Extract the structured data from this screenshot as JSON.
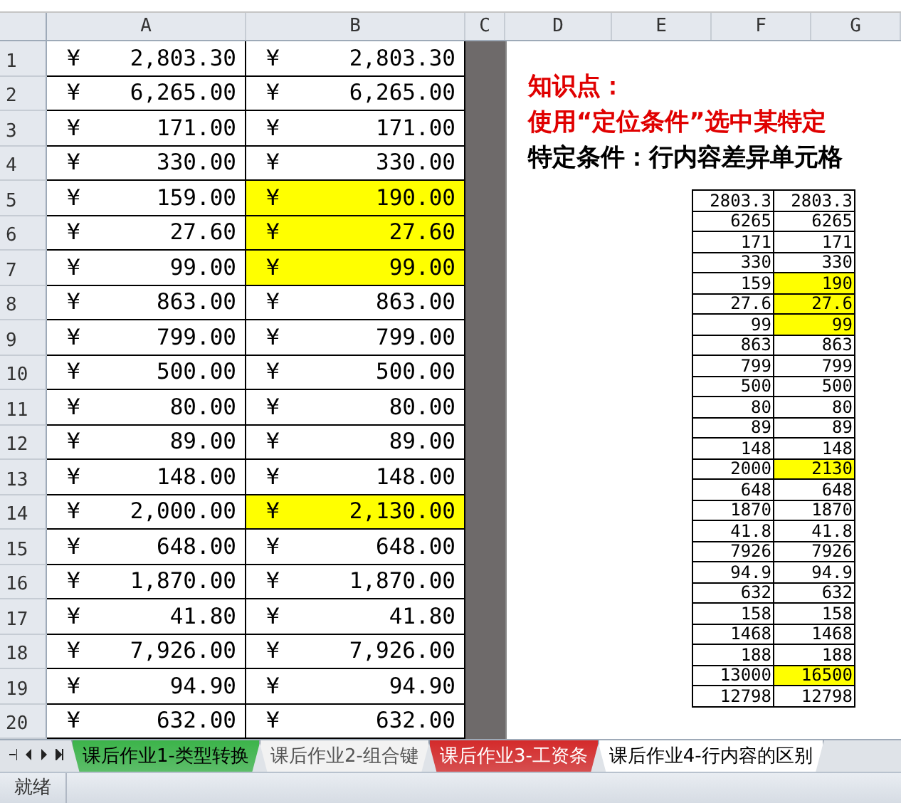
{
  "columns": [
    "A",
    "B",
    "C",
    "D",
    "E",
    "F",
    "G"
  ],
  "rows": [
    {
      "number": "1",
      "a": "2,803.30",
      "b": "2,803.30",
      "highlighted": false
    },
    {
      "number": "2",
      "a": "6,265.00",
      "b": "6,265.00",
      "highlighted": false
    },
    {
      "number": "3",
      "a": "171.00",
      "b": "171.00",
      "highlighted": false
    },
    {
      "number": "4",
      "a": "330.00",
      "b": "330.00",
      "highlighted": false
    },
    {
      "number": "5",
      "a": "159.00",
      "b": "190.00",
      "highlighted": true
    },
    {
      "number": "6",
      "a": "27.60",
      "b": "27.60",
      "highlighted": true
    },
    {
      "number": "7",
      "a": "99.00",
      "b": "99.00",
      "highlighted": true
    },
    {
      "number": "8",
      "a": "863.00",
      "b": "863.00",
      "highlighted": false
    },
    {
      "number": "9",
      "a": "799.00",
      "b": "799.00",
      "highlighted": false
    },
    {
      "number": "10",
      "a": "500.00",
      "b": "500.00",
      "highlighted": false
    },
    {
      "number": "11",
      "a": "80.00",
      "b": "80.00",
      "highlighted": false
    },
    {
      "number": "12",
      "a": "89.00",
      "b": "89.00",
      "highlighted": false
    },
    {
      "number": "13",
      "a": "148.00",
      "b": "148.00",
      "highlighted": false
    },
    {
      "number": "14",
      "a": "2,000.00",
      "b": "2,130.00",
      "highlighted": true
    },
    {
      "number": "15",
      "a": "648.00",
      "b": "648.00",
      "highlighted": false
    },
    {
      "number": "16",
      "a": "1,870.00",
      "b": "1,870.00",
      "highlighted": false
    },
    {
      "number": "17",
      "a": "41.80",
      "b": "41.80",
      "highlighted": false
    },
    {
      "number": "18",
      "a": "7,926.00",
      "b": "7,926.00",
      "highlighted": false
    },
    {
      "number": "19",
      "a": "94.90",
      "b": "94.90",
      "highlighted": false
    },
    {
      "number": "20",
      "a": "632.00",
      "b": "632.00",
      "highlighted": false
    }
  ],
  "currency": "¥",
  "notes": [
    {
      "text": "知识点：",
      "kind": "heading"
    },
    {
      "text": "使用“定位条件”选中某特定",
      "kind": "heading"
    },
    {
      "text": "特定条件：行内容差异单元格",
      "kind": "body"
    }
  ],
  "small_table": [
    {
      "f": "2803.3",
      "g": "2803.3",
      "highlighted": false
    },
    {
      "f": "6265",
      "g": "6265",
      "highlighted": false
    },
    {
      "f": "171",
      "g": "171",
      "highlighted": false
    },
    {
      "f": "330",
      "g": "330",
      "highlighted": false
    },
    {
      "f": "159",
      "g": "190",
      "highlighted": true
    },
    {
      "f": "27.6",
      "g": "27.6",
      "highlighted": true
    },
    {
      "f": "99",
      "g": "99",
      "highlighted": true
    },
    {
      "f": "863",
      "g": "863",
      "highlighted": false
    },
    {
      "f": "799",
      "g": "799",
      "highlighted": false
    },
    {
      "f": "500",
      "g": "500",
      "highlighted": false
    },
    {
      "f": "80",
      "g": "80",
      "highlighted": false
    },
    {
      "f": "89",
      "g": "89",
      "highlighted": false
    },
    {
      "f": "148",
      "g": "148",
      "highlighted": false
    },
    {
      "f": "2000",
      "g": "2130",
      "highlighted": true
    },
    {
      "f": "648",
      "g": "648",
      "highlighted": false
    },
    {
      "f": "1870",
      "g": "1870",
      "highlighted": false
    },
    {
      "f": "41.8",
      "g": "41.8",
      "highlighted": false
    },
    {
      "f": "7926",
      "g": "7926",
      "highlighted": false
    },
    {
      "f": "94.9",
      "g": "94.9",
      "highlighted": false
    },
    {
      "f": "632",
      "g": "632",
      "highlighted": false
    },
    {
      "f": "158",
      "g": "158",
      "highlighted": false
    },
    {
      "f": "1468",
      "g": "1468",
      "highlighted": false
    },
    {
      "f": "188",
      "g": "188",
      "highlighted": false
    },
    {
      "f": "13000",
      "g": "16500",
      "highlighted": true
    },
    {
      "f": "12798",
      "g": "12798",
      "highlighted": false
    }
  ],
  "sheet_tabs": [
    {
      "label": "课后作业1-类型转换",
      "selected": false,
      "color": "#3cb44a"
    },
    {
      "label": "课后作业2-组合键",
      "selected": false
    },
    {
      "label": "课后作业3-工资条",
      "selected": false,
      "color": "#d42a2a"
    },
    {
      "label": "课后作业4-行内容的区别",
      "selected": true
    }
  ],
  "status_bar": {
    "text": "就绪"
  }
}
